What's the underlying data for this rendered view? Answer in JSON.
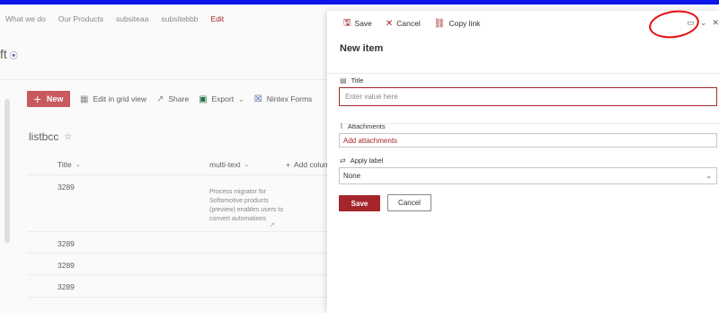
{
  "site_nav": [
    "What we do",
    "Our Products",
    "subsiteaa",
    "subsitebbb"
  ],
  "site_nav_edit": "Edit",
  "site_logo": "ft",
  "command_bar": {
    "new_label": "New",
    "edit_grid_label": "Edit in grid view",
    "share_label": "Share",
    "export_label": "Export",
    "nintex_label": "Nintex Forms"
  },
  "list": {
    "title": "listbcc",
    "columns": [
      "Title",
      "multi-text",
      "Add column"
    ],
    "rows": [
      "3289",
      "3289",
      "3289",
      "3289"
    ],
    "multi_text_preview": "Process migrator for Softomotive products (preview) enables users to convert automations"
  },
  "panel": {
    "toolbar": {
      "save": "Save",
      "cancel": "Cancel",
      "copy_link": "Copy link"
    },
    "title": "New item",
    "fields": {
      "title_label": "Title",
      "title_placeholder": "Enter value here",
      "attachments_label": "Attachments",
      "add_attachments": "Add attachments",
      "apply_label_label": "Apply label",
      "apply_label_value": "None"
    },
    "save_button": "Save",
    "cancel_button": "Cancel"
  },
  "colors": {
    "accent": "#a4262c",
    "new_button": "#c9595f",
    "top_bar": "#0b16e8",
    "annotation_circle": "#e30d12"
  }
}
